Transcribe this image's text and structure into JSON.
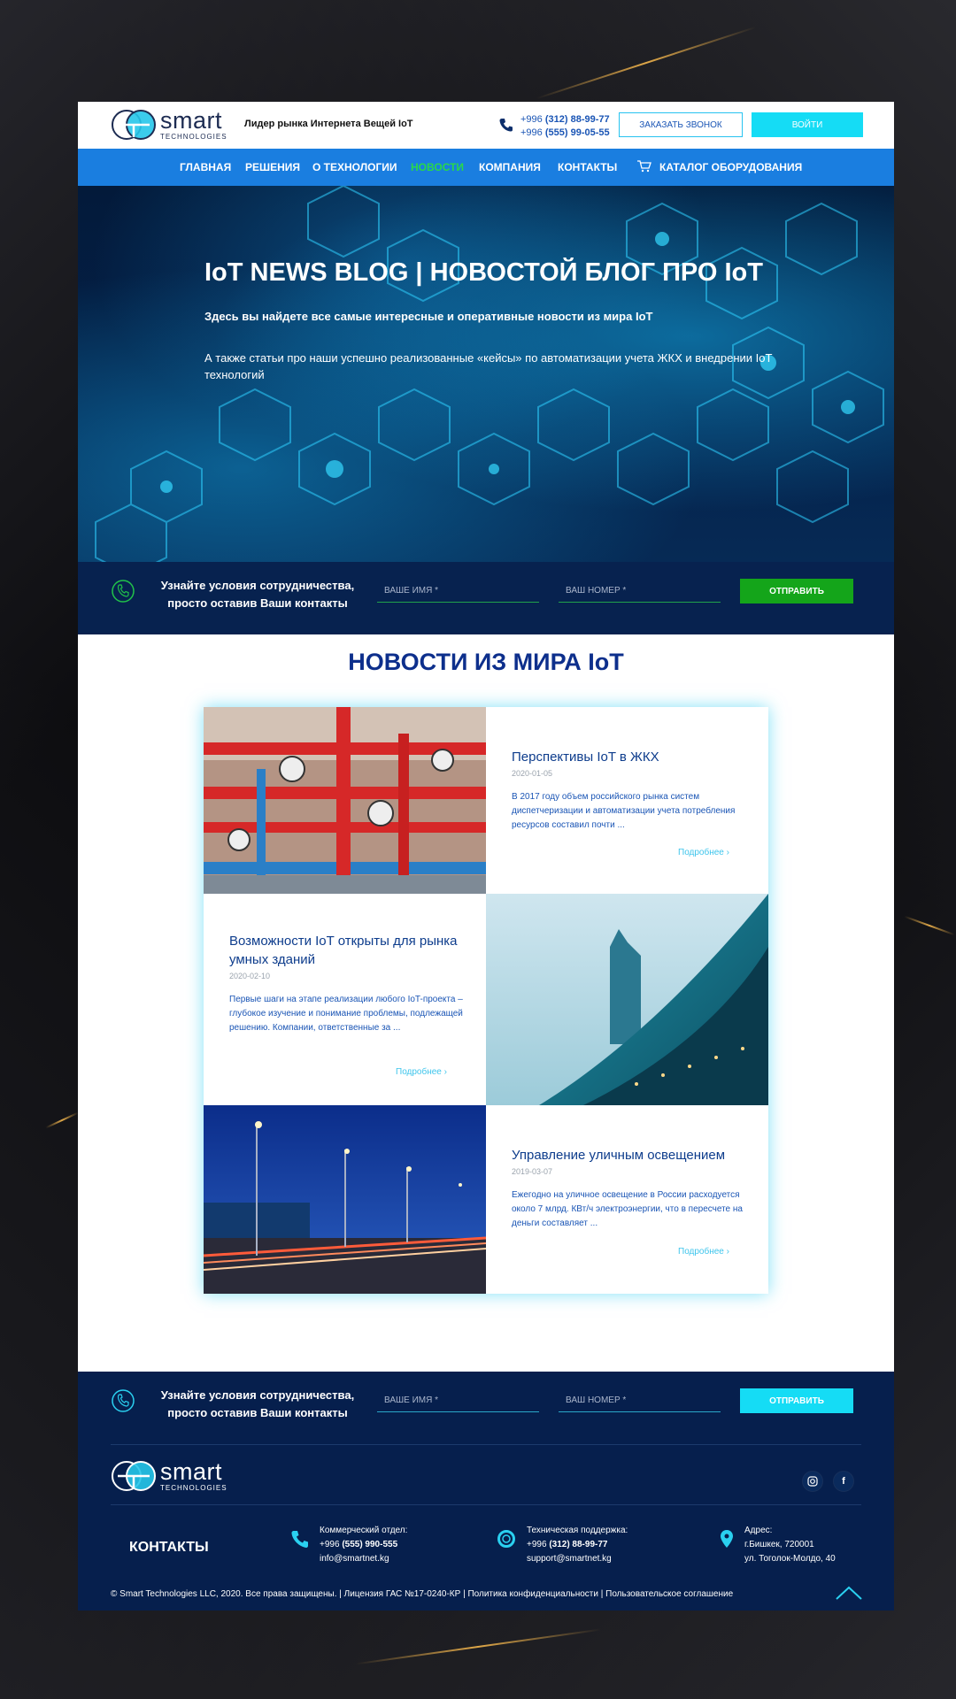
{
  "colors": {
    "nav_bg": "#1a7ee0",
    "nav_active": "#28d84a",
    "accent_cyan": "#15dcf5",
    "band_bg": "#07224f",
    "footer_bg": "#061f4d",
    "title_blue": "#0d2f8c",
    "send_green": "#14a51a"
  },
  "header": {
    "logo_word": "smart",
    "logo_sub": "TECHNOLOGIES",
    "tagline": "Лидер рынка Интернета Вещей IoT",
    "phone1_prefix": "+996 ",
    "phone1_main": "(312) 88-99-77",
    "phone2_prefix": "+996 ",
    "phone2_main": "(555) 99-05-55",
    "call_button": "ЗАКАЗАТЬ ЗВОНОК",
    "login_button": "ВОЙТИ"
  },
  "nav": {
    "items": [
      "ГЛАВНАЯ",
      "РЕШЕНИЯ",
      "О ТЕХНОЛОГИИ",
      "НОВОСТИ",
      "КОМПАНИЯ",
      "КОНТАКТЫ"
    ],
    "active": "НОВОСТИ",
    "catalog": "КАТАЛОГ ОБОРУДОВАНИЯ"
  },
  "hero": {
    "title": "IoT NEWS BLOG | НОВОСТОЙ БЛОГ ПРО IoT",
    "subtitle": "Здесь вы найдете все самые интересные и оперативные новости из мира IoT",
    "text": "А также статьи про наши успешно реализованные «кейсы» по автоматизации учета ЖКХ и внедрении IoT технологий"
  },
  "contact_band": {
    "text": "Узнайте условия сотрудничества, просто оставив Ваши контакты",
    "name_placeholder": "ВАШЕ ИМЯ *",
    "phone_placeholder": "ВАШ НОМЕР *",
    "send_button": "ОТПРАВИТЬ"
  },
  "news": {
    "section_title": "НОВОСТИ ИЗ МИРА IoT",
    "more_label": "Подробнее",
    "items": [
      {
        "title": "Перспективы IoT в ЖКХ",
        "date": "2020-01-05",
        "excerpt": "В 2017 году объем российского рынка систем диспетчеризации и автоматизации учета потребления ресурсов составил почти ...",
        "image": "heating-pipes-photo"
      },
      {
        "title": "Возможности IoT открыты для рынка умных зданий",
        "date": "2020-02-10",
        "excerpt": "Первые шаги на этапе реализации любого IoT-проекта – глубокое изучение и понимание проблемы, подлежащей решению. Компании, ответственные за ...",
        "image": "glass-skyscraper-photo"
      },
      {
        "title": "Управление уличным освещением",
        "date": "2019-03-07",
        "excerpt": "Ежегодно на уличное освещение в России расходуется около 7 млрд. КВт/ч электроэнергии, что в пересчете на деньги составляет ...",
        "image": "night-street-lights-photo"
      }
    ]
  },
  "footer": {
    "commercial_label": "Коммерческий отдел:",
    "commercial_phone_prefix": "+996 ",
    "commercial_phone_main": "(555) 990-555",
    "commercial_email": "info@smartnet.kg",
    "support_label": "Техническая поддержка:",
    "support_phone_prefix": "+996 ",
    "support_phone_main": "(312) 88-99-77",
    "support_email": "support@smartnet.kg",
    "address_label": "Адрес:",
    "address_city": "г.Бишкек, 720001",
    "address_street": "ул. Тоголок-Молдо, 40",
    "contacts_title": "КОНТАКТЫ",
    "copyright": "© Smart Technologies LLC, 2020. Все права защищены. | Лицензия ГАС №17-0240-КР | Политика конфиденциальности | Пользовательское соглашение",
    "social": [
      "instagram-icon",
      "facebook-icon"
    ]
  }
}
